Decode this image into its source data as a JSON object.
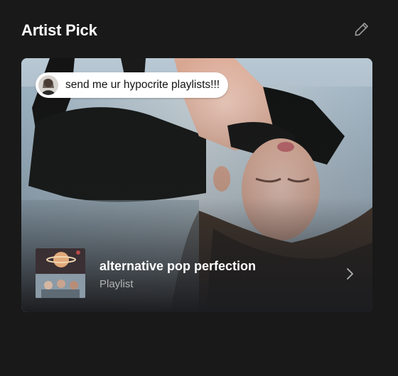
{
  "section": {
    "title": "Artist Pick"
  },
  "pick": {
    "comment": "send me ur hypocrite playlists!!!",
    "playlist_name": "alternative pop perfection",
    "playlist_type": "Playlist"
  },
  "icons": {
    "edit": "pencil-icon",
    "open": "chevron-right-icon"
  },
  "colors": {
    "background": "#191919",
    "text_primary": "#ffffff",
    "text_secondary": "#b3b3b3"
  }
}
